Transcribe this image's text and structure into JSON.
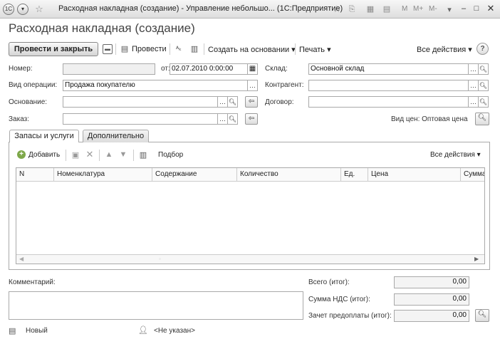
{
  "window": {
    "title": "Расходная накладная (создание) - Управление небольшо... (1С:Предприятие)",
    "title_right": {
      "m": "M",
      "m_plus": "M+",
      "m_minus": "M-"
    }
  },
  "document": {
    "title": "Расходная накладная (создание)"
  },
  "toolbar": {
    "post_and_close": "Провести и закрыть",
    "post": "Провести",
    "create_based_on": "Создать на основании",
    "print": "Печать",
    "all_actions": "Все действия",
    "help": "?"
  },
  "form": {
    "number_label": "Номер:",
    "number_value": "",
    "date_label": "от:",
    "date_value": "02.07.2010  0:00:00",
    "warehouse_label": "Склад:",
    "warehouse_value": "Основной склад",
    "operation_label": "Вид операции:",
    "operation_value": "Продажа покупателю",
    "counterparty_label": "Контрагент:",
    "counterparty_value": "",
    "basis_label": "Основание:",
    "basis_value": "",
    "contract_label": "Договор:",
    "contract_value": "",
    "order_label": "Заказ:",
    "order_value": "",
    "price_type_text": "Вид цен: Оптовая цена"
  },
  "tabs": [
    {
      "label": "Запасы и услуги"
    },
    {
      "label": "Дополнительно"
    }
  ],
  "table_toolbar": {
    "add": "Добавить",
    "selection": "Подбор",
    "all_actions": "Все действия"
  },
  "table": {
    "columns": [
      "N",
      "Номенклатура",
      "Содержание",
      "Количество",
      "Ед.",
      "Цена",
      "Сумма"
    ],
    "rows": []
  },
  "bottom": {
    "comment_label": "Комментарий:",
    "comment_value": "",
    "total_label": "Всего (итог):",
    "total_value": "0,00",
    "vat_label": "Сумма НДС (итог):",
    "vat_value": "0,00",
    "prepay_label": "Зачет предоплаты (итог):",
    "prepay_value": "0,00"
  },
  "status": {
    "state": "Новый",
    "responsible": "<Не указан>"
  }
}
